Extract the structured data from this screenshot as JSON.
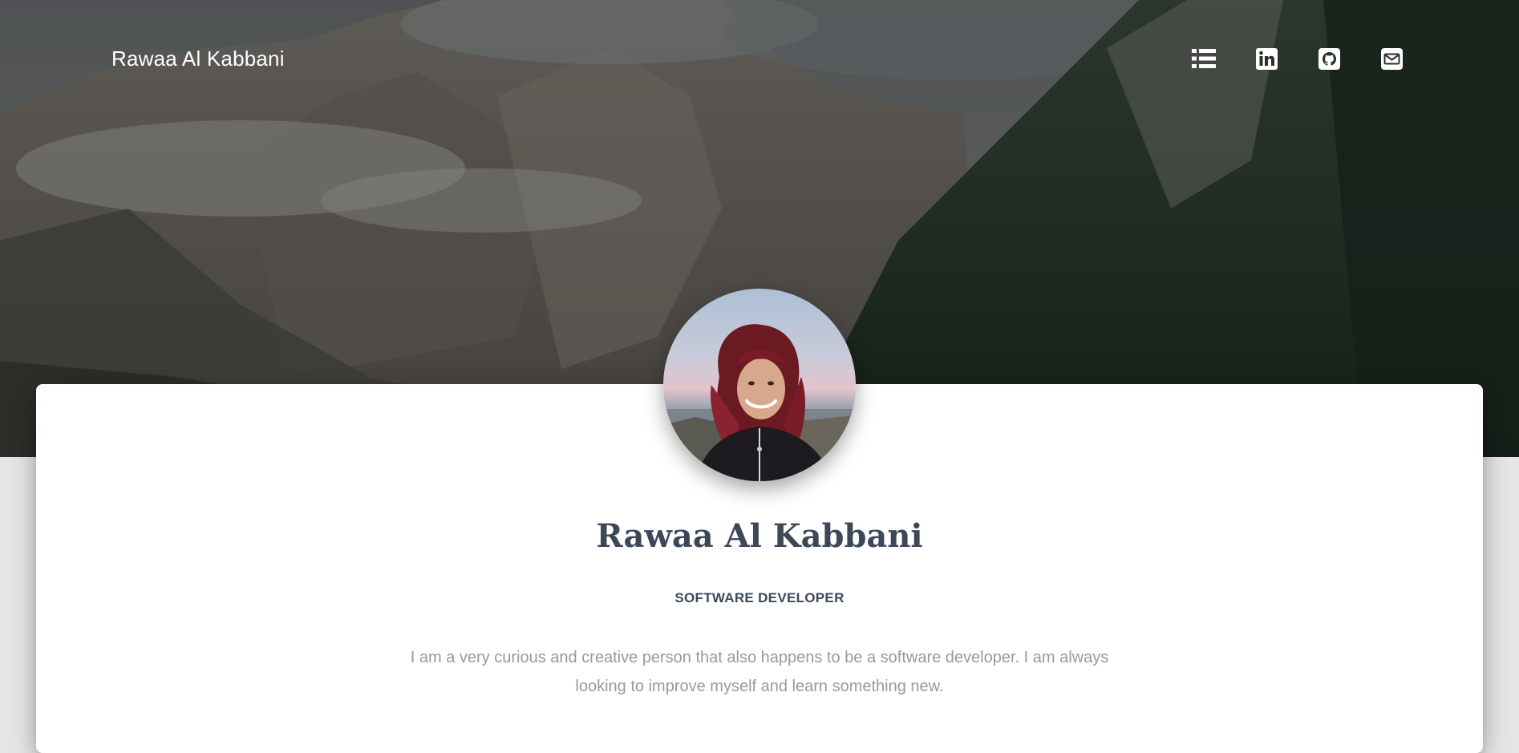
{
  "header": {
    "brand": "Rawaa Al Kabbani",
    "icons": [
      "list-icon",
      "linkedin-icon",
      "github-icon",
      "envelope-icon"
    ]
  },
  "profile": {
    "name": "Rawaa Al Kabbani",
    "role": "SOFTWARE DEVELOPER",
    "bio": "I am a very curious and creative person that also happens to be a software developer. I am always looking to improve myself and learn something new."
  },
  "colors": {
    "heading": "#3c4858",
    "muted": "#999999",
    "card": "#ffffff",
    "page": "#e5e5e5"
  }
}
